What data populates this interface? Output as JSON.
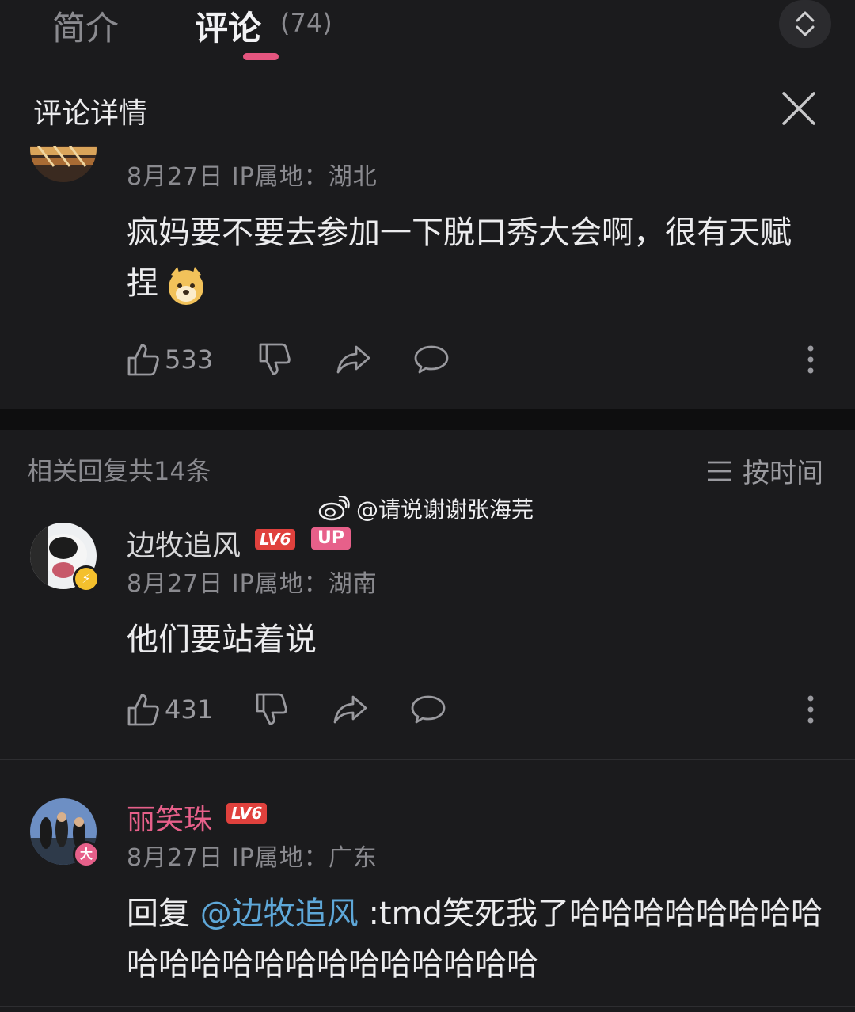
{
  "tabs": {
    "intro": "简介",
    "comments": "评论",
    "count": "(74)"
  },
  "detail": {
    "title": "评论详情"
  },
  "main_comment": {
    "meta": "8月27日  IP属地：湖北",
    "text": "疯妈要不要去参加一下脱口秀大会啊，很有天赋捏",
    "emoji": "doge-emoji",
    "likes": "533"
  },
  "replies_header": {
    "count_label": "相关回复共14条",
    "sort_label": "按时间"
  },
  "watermark": {
    "text": "@请说谢谢张海芫"
  },
  "replies": [
    {
      "username": "边牧追风",
      "level": "LV6",
      "up_tag": "UP",
      "meta": "8月27日  IP属地：湖南",
      "text": "他们要站着说",
      "likes": "431",
      "name_color": "#d8d8da"
    },
    {
      "username": "丽笑珠",
      "level": "LV6",
      "meta": "8月27日  IP属地：广东",
      "reply_prefix": "回复",
      "mention": "@边牧追风",
      "text": ":tmd笑死我了哈哈哈哈哈哈哈哈哈哈哈哈哈哈哈哈哈哈哈哈哈",
      "name_color": "#e7608a"
    }
  ],
  "colors": {
    "accent": "#e5557f",
    "mention": "#5ea7d8",
    "level": "#e0413d"
  }
}
